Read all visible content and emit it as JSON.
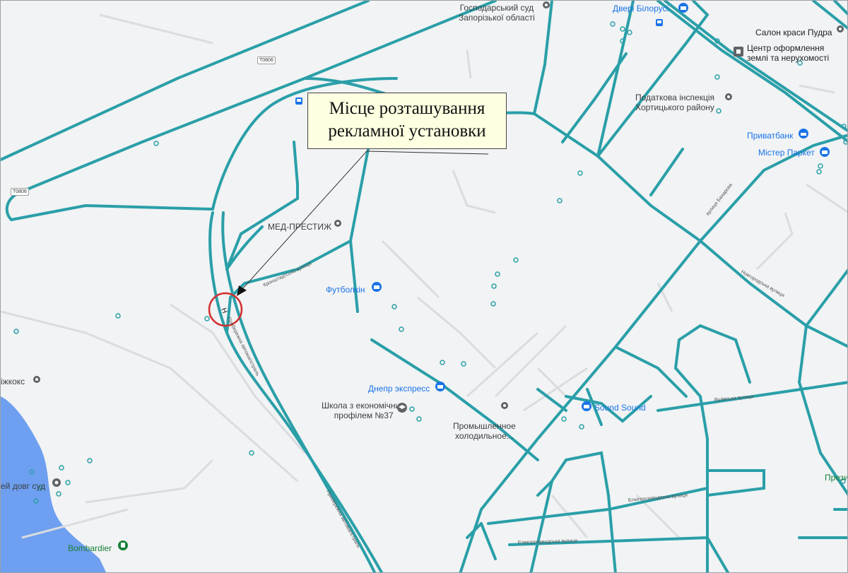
{
  "callout": {
    "line1": "Місце розташування",
    "line2": "рекламної установки"
  },
  "colors": {
    "road": "#2a9fa8",
    "water": "#6e9ff0",
    "marker_circle": "#d32f2f",
    "poi_blue": "#1a73e8",
    "poi_gray": "#5f6368",
    "poi_green": "#188038"
  },
  "shields": {
    "t0806_top": "T0806",
    "t0806_left": "T0806"
  },
  "pois": {
    "court": {
      "line1": "Господарський суд",
      "line2": "Запорізької області"
    },
    "doors": "Двері Білорусі",
    "salon": "Салон краси Пудра",
    "center": {
      "line1": "Центр оформлення",
      "line2": "землі та нерухомості"
    },
    "tax": {
      "line1": "Податкова інспекція",
      "line2": "Хортицького району"
    },
    "privat": "Приватбанк",
    "parket": "Містер Паркет",
    "med": "МЕД-ПРЕСТИЖ",
    "futbolkin": "Футболкін",
    "koks": "іжкокс",
    "dnepr": "Днепр экспресс",
    "school": {
      "line1": "Школа з економічним",
      "line2": "профілем №37"
    },
    "cold": {
      "line1": "Промышленное",
      "line2": "холодильное..."
    },
    "sound": "Sound Sound",
    "court2": "ей довг суд",
    "bombardier": "Bombardier",
    "prezid": "Прези"
  },
  "streets": {
    "pryberezhna_a": "Прибережна автомагістраль",
    "pryberezhna_b": "Прибережна автомагістраль",
    "kronshtadtska": "Кронштадтська вулиця",
    "elektrozavodska": "Електрозаводська вулиця",
    "elektrozavodska2": "Електрозаводська вулиця",
    "vuzivska": "Вузівська вулиця",
    "novhorodska": "Новгородська вулиця",
    "bukhar": "вулиця Бахарєва"
  },
  "marker_symbol": "Н"
}
